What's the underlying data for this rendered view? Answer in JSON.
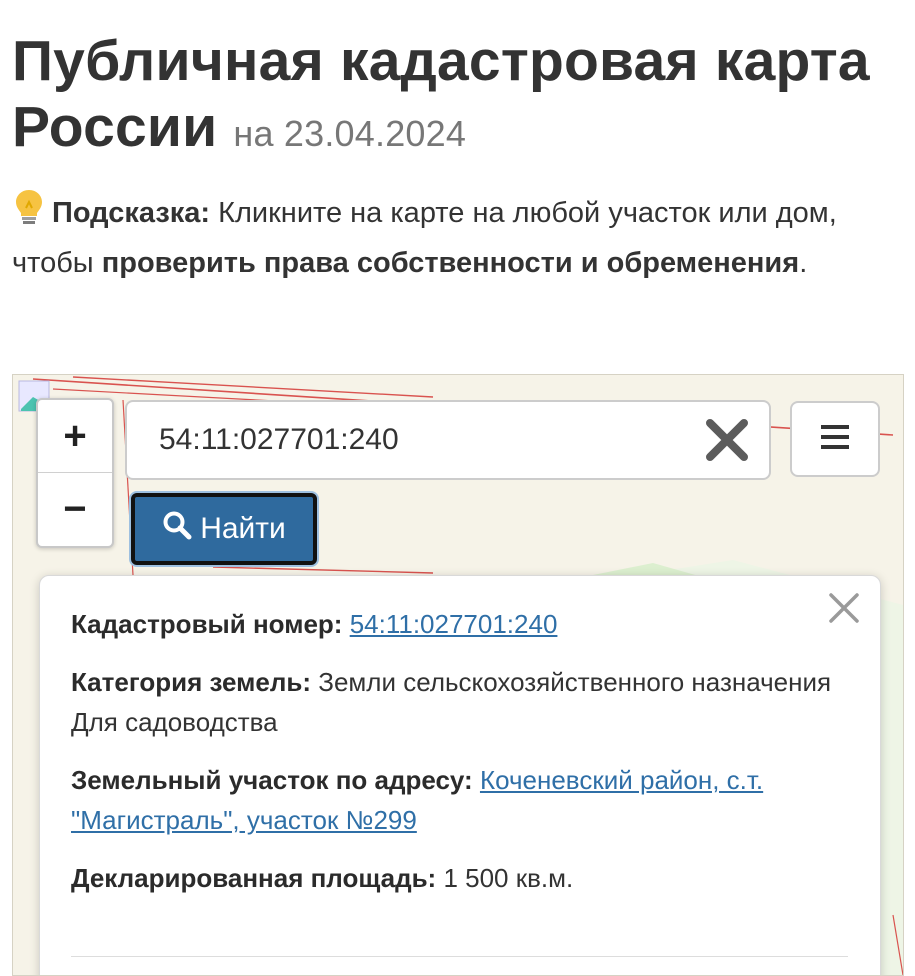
{
  "header": {
    "title": "Публичная кадастровая карта России",
    "date": "на 23.04.2024"
  },
  "hint": {
    "label": "Подсказка:",
    "text_before": " Кликните на карте на любой участок или дом, чтобы ",
    "bold_text": "проверить права собственности и обременения",
    "text_after": "."
  },
  "map": {
    "zoom_in": "+",
    "zoom_out": "−",
    "search": {
      "value": "54:11:027701:240",
      "placeholder": ""
    },
    "find_button": "Найти"
  },
  "popup": {
    "cadastral": {
      "label": "Кадастровый номер:",
      "value": "54:11:027701:240"
    },
    "category": {
      "label": "Категория земель:",
      "value": "Земли сельскохозяйственного назначения",
      "use": "Для садоводства"
    },
    "address": {
      "label": "Земельный участок по адресу:",
      "value": "Коченевский район, с.т. \"Магистраль\", участок №299"
    },
    "area": {
      "label": "Декларированная площадь:",
      "value": "1 500 кв.м."
    }
  },
  "icons": {
    "hint": "lightbulb-icon",
    "clear": "close-icon",
    "menu": "hamburger-menu-icon",
    "find": "search-icon",
    "popup_close": "close-icon"
  },
  "colors": {
    "accent": "#2f6a9e",
    "link": "#2f6fa7",
    "cadastre_line": "#d9534f"
  }
}
